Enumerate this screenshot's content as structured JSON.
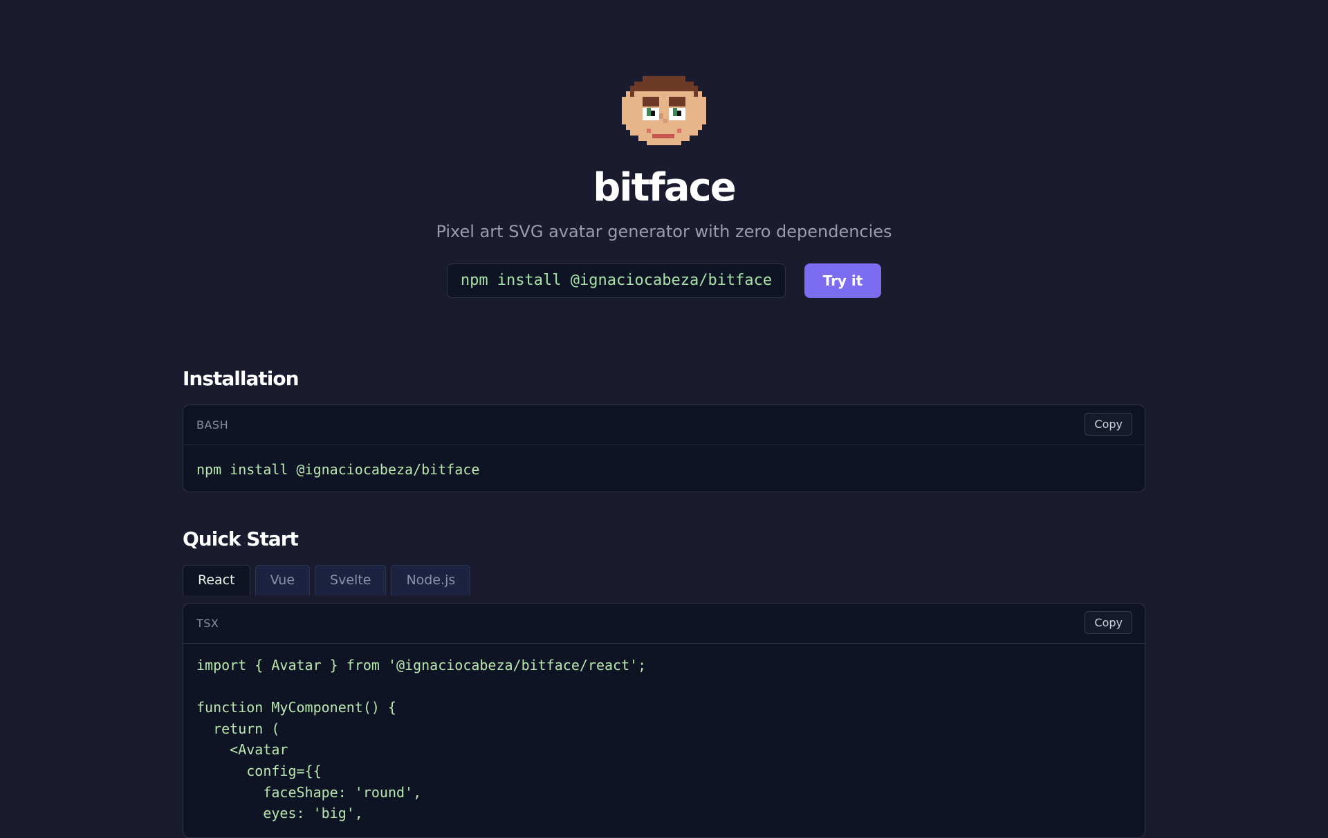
{
  "hero": {
    "logo_icon": "pixel-face-avatar",
    "title": "bitface",
    "subtitle": "Pixel art SVG avatar generator with zero dependencies",
    "install_command": "npm install @ignaciocabeza/bitface",
    "try_button": "Try it"
  },
  "installation": {
    "title": "Installation",
    "lang": "BASH",
    "copy_label": "Copy",
    "code": "npm install @ignaciocabeza/bitface"
  },
  "quick_start": {
    "title": "Quick Start",
    "tabs": [
      {
        "label": "React",
        "active": true
      },
      {
        "label": "Vue",
        "active": false
      },
      {
        "label": "Svelte",
        "active": false
      },
      {
        "label": "Node.js",
        "active": false
      }
    ],
    "lang": "TSX",
    "copy_label": "Copy",
    "code": "import { Avatar } from '@ignaciocabeza/bitface/react';\n\nfunction MyComponent() {\n  return (\n    <Avatar\n      config={{\n        faceShape: 'round',\n        eyes: 'big',"
  },
  "colors": {
    "background": "#1a1b2e",
    "code_background": "#0f1424",
    "accent": "#7b6cf0",
    "code_text": "#b9e7b0",
    "muted_text": "#9a9bab"
  }
}
